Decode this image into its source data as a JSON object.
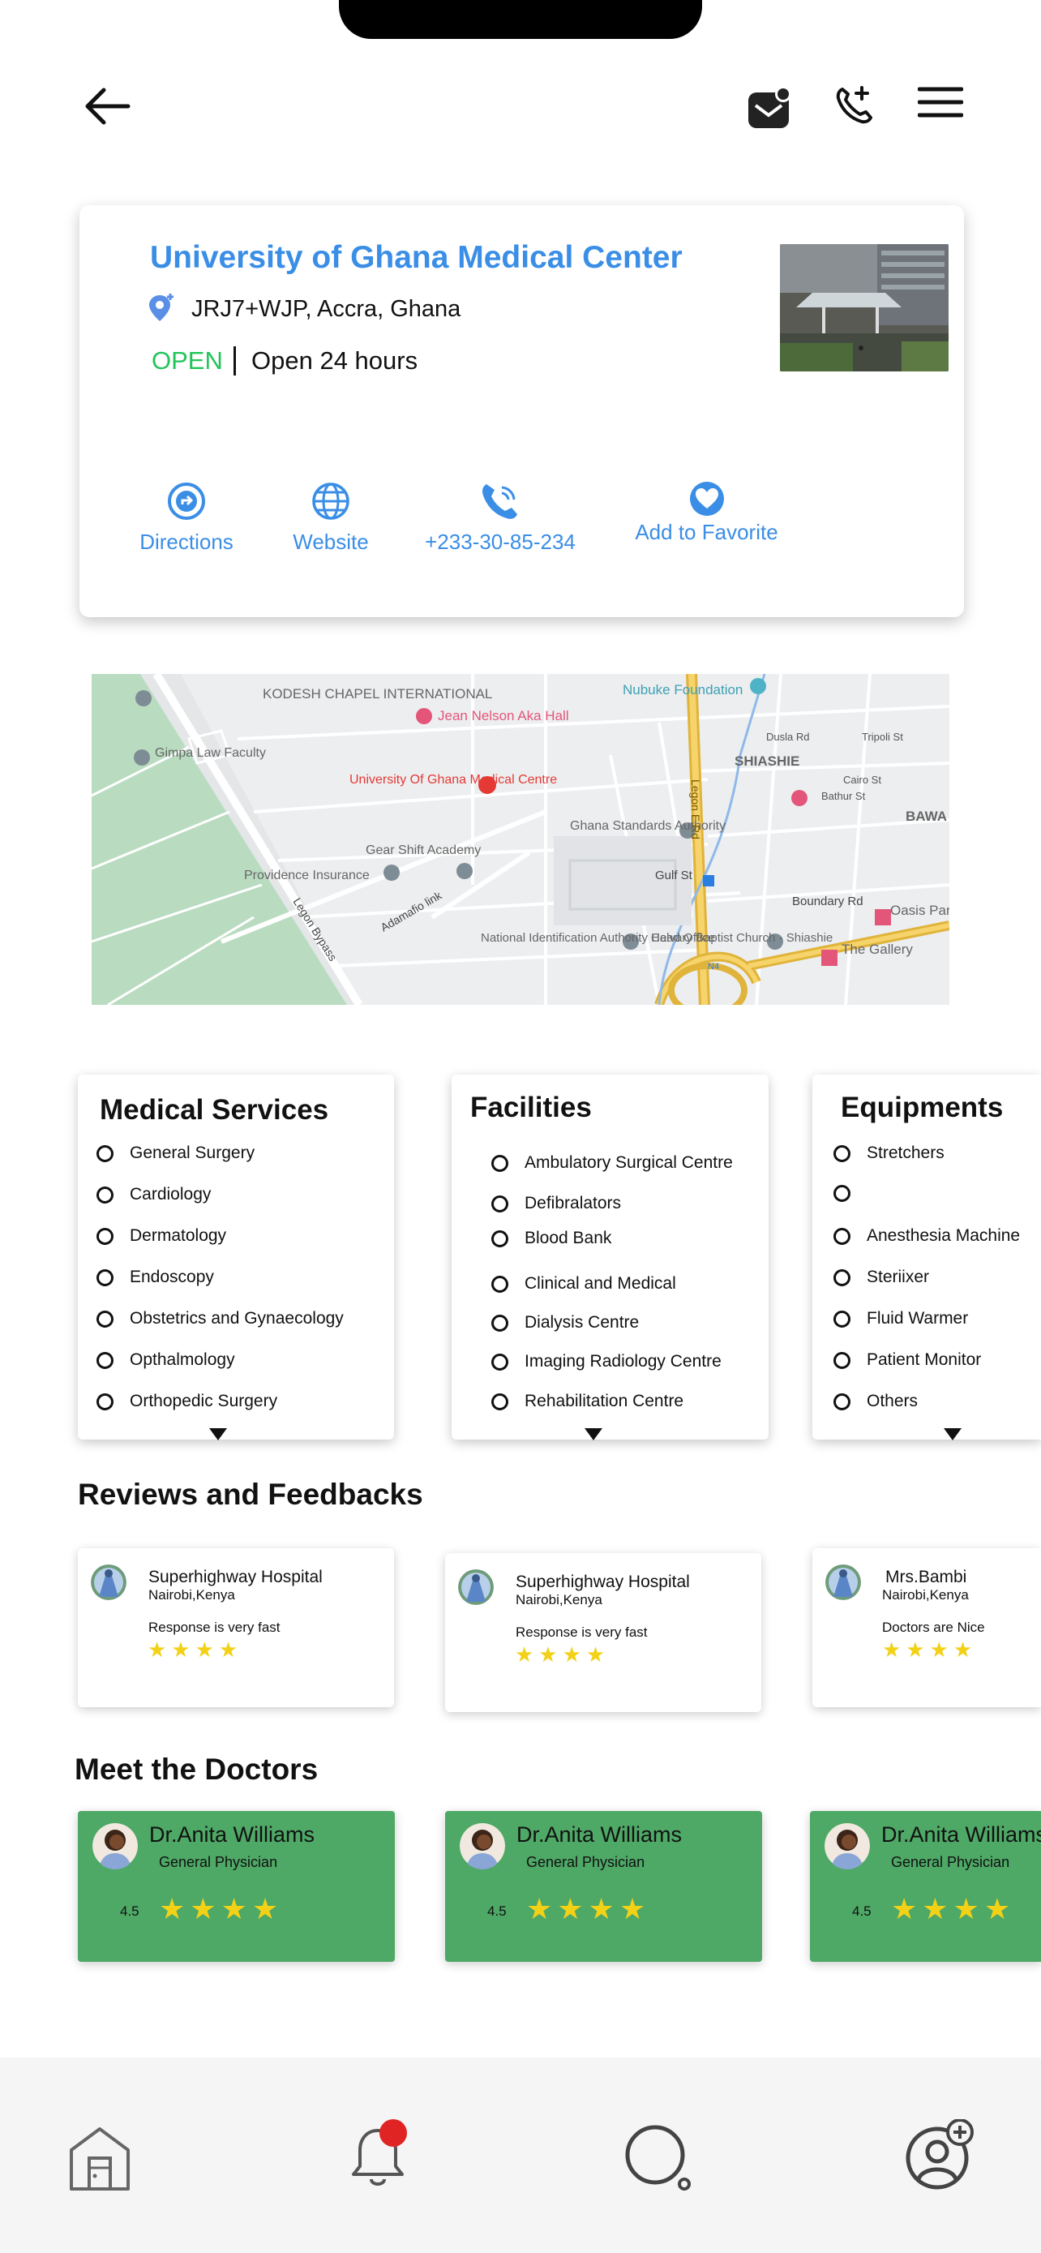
{
  "header": {
    "back_icon": "arrow-left-icon",
    "mail_icon": "mail-notification-icon",
    "call_icon": "phone-add-icon",
    "menu_icon": "hamburger-menu-icon"
  },
  "hospital": {
    "name": "University of Ghana Medical Center",
    "address": "JRJ7+WJP, Accra, Ghana",
    "status": "OPEN",
    "hours": "Open 24 hours",
    "actions": [
      {
        "label": "Directions",
        "icon": "directions-icon"
      },
      {
        "label": "Website",
        "icon": "globe-icon"
      },
      {
        "label": "+233-30-85-234",
        "icon": "phone-icon"
      },
      {
        "label": "Add to Favorite",
        "icon": "heart-icon"
      }
    ]
  },
  "map": {
    "labels": [
      "KODESH CHAPEL INTERNATIONAL",
      "Jean Nelson Aka Hall",
      "Nubuke Foundation",
      "Gimpa Law Faculty",
      "University Of Ghana Medical Centre",
      "SHIASHIE",
      "BAWA",
      "Gear Shift Academy",
      "Ghana Standards Authority",
      "Providence Insurance",
      "Legon E Rd",
      "Gulf St",
      "Boundary Rd",
      "Oasis Park",
      "National Identification Authority Head Office",
      "Calvary Baptist Church - Shiashie",
      "The Gallery",
      "Legon Bypass",
      "Adamafio link",
      "Tripoli St",
      "Dusla Rd",
      "Cairo St",
      "Bathur St",
      "N4"
    ]
  },
  "services": {
    "medical": {
      "title": "Medical Services",
      "items": [
        "General Surgery",
        "Cardiology",
        "Dermatology",
        "Endoscopy",
        "Obstetrics and Gynaecology",
        "Opthalmology",
        "Orthopedic Surgery"
      ]
    },
    "facilities": {
      "title": "Facilities",
      "items": [
        "Ambulatory Surgical Centre",
        "Defibralators",
        "Blood Bank",
        "Clinical and Medical",
        "Dialysis Centre",
        "Imaging Radiology Centre",
        "Rehabilitation Centre"
      ]
    },
    "equipments": {
      "title": "Equipments",
      "items": [
        "Stretchers",
        "",
        "Anesthesia Machine",
        "Steriixer",
        "Fluid Warmer",
        "Patient Monitor",
        "Others"
      ]
    }
  },
  "reviews": {
    "title": "Reviews and Feedbacks",
    "items": [
      {
        "name": "Superhighway Hospital",
        "location": "Nairobi,Kenya",
        "text": "Response is very fast",
        "stars": "★★★★"
      },
      {
        "name": "Superhighway Hospital",
        "location": "Nairobi,Kenya",
        "text": "Response is very fast",
        "stars": "★★★★"
      },
      {
        "name": "Mrs.Bambi",
        "location": "Nairobi,Kenya",
        "text": "Doctors are Nice",
        "stars": "★★★★"
      }
    ]
  },
  "doctors": {
    "title": "Meet the Doctors",
    "items": [
      {
        "name": "Dr.Anita Williams",
        "role": "General Physician",
        "rating": "4.5",
        "stars": "★★★★"
      },
      {
        "name": "Dr.Anita Williams",
        "role": "General Physician",
        "rating": "4.5",
        "stars": "★★★★"
      },
      {
        "name": "Dr.Anita Williams",
        "role": "General Physician",
        "rating": "4.5",
        "stars": "★★★★"
      }
    ]
  },
  "bottom_nav": {
    "items": [
      "home-icon",
      "notification-bell-icon",
      "search-icon",
      "add-user-profile-icon"
    ]
  },
  "colors": {
    "accent": "#3a8ee6",
    "open": "#22c45a",
    "doctor_card": "#4ea866",
    "stars": "#f2d116",
    "badge": "#e02424"
  }
}
